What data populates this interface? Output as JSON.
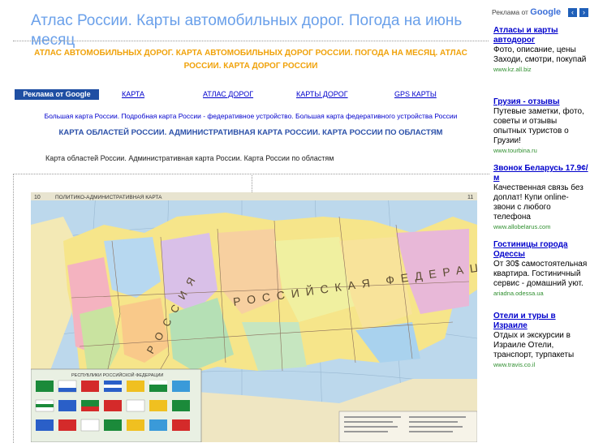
{
  "header": {
    "title": "Атлас России. Карты автомобильных дорог. Погода на июнь месяц",
    "subtitle": "АТЛАС АВТОМОБИЛЬНЫХ ДОРОГ. КАРТА АВТОМОБИЛЬНЫХ ДОРОГ РОССИИ. ПОГОДА НА МЕСЯЦ. АТЛАС РОССИИ. КАРТА ДОРОГ РОССИИ"
  },
  "nav": {
    "ads_label": "Реклама от Google",
    "links": [
      "КАРТА",
      "АТЛАС ДОРОГ",
      "КАРТЫ ДОРОГ",
      "GPS КАРТЫ"
    ]
  },
  "breadcrumb": "Большая карта России. Подробная карта России - федеративное устройство. Большая карта федеративного устройства России",
  "main": {
    "heading": "КАРТА ОБЛАСТЕЙ РОССИИ. АДМИНИСТРАТИВНАЯ КАРТА РОССИИ. КАРТА РОССИИ ПО ОБЛАСТЯМ",
    "caption": "Карта областей России. Административная карта России. Карта России по областям",
    "map": {
      "page_left": "10",
      "page_right": "11",
      "map_title": "ПОЛИТИКО-АДМИНИСТРАТИВНАЯ КАРТА",
      "flags_title": "РЕСПУБЛИКИ РОССИЙСКОЙ ФЕДЕРАЦИИ",
      "label_russia": "РОССИЙСКАЯ ФЕДЕРАЦИЯ",
      "label_rossiya": "РОССИЯ"
    }
  },
  "sidebar": {
    "ads_prefix": "Реклама от",
    "ads_brand": "Google",
    "prev": "‹",
    "next": "›",
    "ads": [
      {
        "title": "Атласы и карты автодорог",
        "text": "Фото, описание, цены Заходи, смотри, покупай",
        "url": "www.kz.all.biz"
      },
      {
        "title": "Грузия - отзывы",
        "text": "Путевые заметки, фото, советы и отзывы опытных туристов о Грузии!",
        "url": "www.tourbina.ru"
      },
      {
        "title": "Звонок Беларусь 17.9¢/м",
        "text": "Качественная связь без доплат! Купи online-звони с любого телефона",
        "url": "www.allobelarus.com"
      },
      {
        "title": "Гостиницы города Одессы",
        "text": "От 30$ самостоятельная квартира. Гостиничный сервис - домашний уют.",
        "url": "ariadna.odessa.ua"
      },
      {
        "title": "Отели и туры в Израиле",
        "text": "Отдых и экскурсии в Израиле Отели, транспорт, турпакеты",
        "url": "www.travis.co.il"
      }
    ]
  },
  "colors": {
    "accent": "#6aa0ea",
    "orange": "#f0a20a",
    "link": "#0000cc",
    "url": "#2f8f2f"
  }
}
